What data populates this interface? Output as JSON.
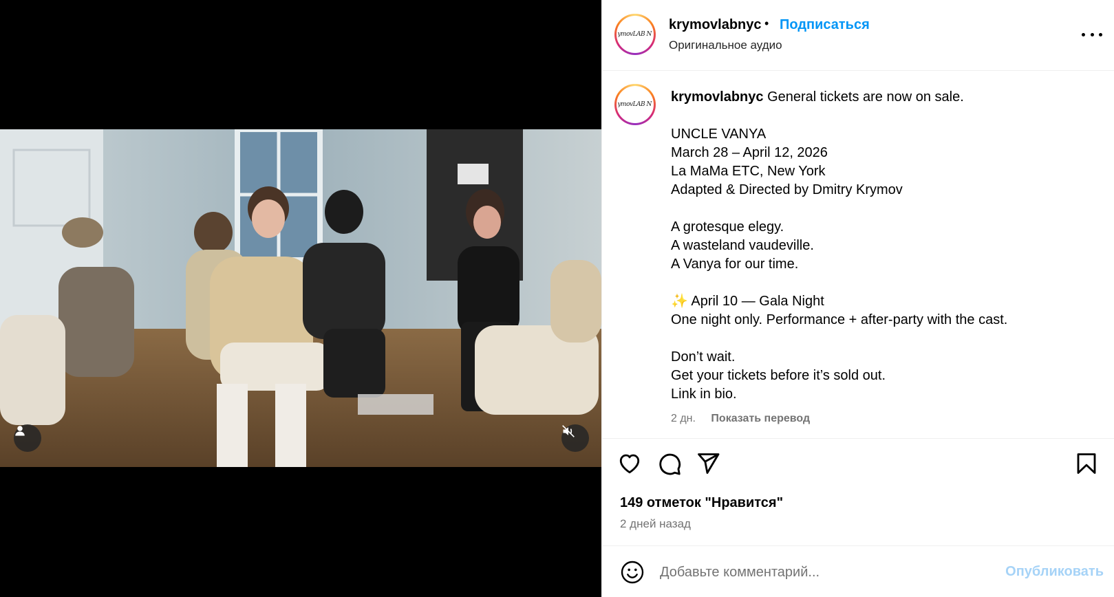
{
  "post": {
    "username": "krymovlabnyc",
    "follow_label": "Подписаться",
    "separator": "•",
    "audio_label": "Оригинальное аудио",
    "avatar_logo_text": "KrymovLAB NYC"
  },
  "caption": {
    "username": "krymovlabnyc",
    "text": " General tickets are now on sale.\n\nUNCLE VANYA\nMarch 28 – April 12, 2026\nLa MaMa ETC, New York\nAdapted & Directed by Dmitry Krymov\n\nA grotesque elegy.\nA wasteland vaudeville.\nA Vanya for our time.\n\n✨ April 10 — Gala Night\nOne night only. Performance + after-party with the cast.\n\nDon’t wait.\nGet your tickets before it’s sold out.\nLink in bio.",
    "age": "2 дн.",
    "translate_label": "Показать перевод"
  },
  "engagement": {
    "likes_text": "149 отметок \"Нравится\"",
    "time_text": "2 дней назад"
  },
  "comment_box": {
    "placeholder": "Добавьте комментарий...",
    "publish_label": "Опубликовать"
  },
  "icons": {
    "like": "heart-icon",
    "comment": "comment-icon",
    "share": "share-icon",
    "save": "bookmark-icon",
    "more": "more-icon",
    "emoji": "emoji-icon",
    "tag": "user-tag-icon",
    "mute": "muted-speaker-icon"
  },
  "colors": {
    "accent": "#0095f6",
    "publish_disabled": "#a6d3f7",
    "secondary_text": "#737373"
  }
}
